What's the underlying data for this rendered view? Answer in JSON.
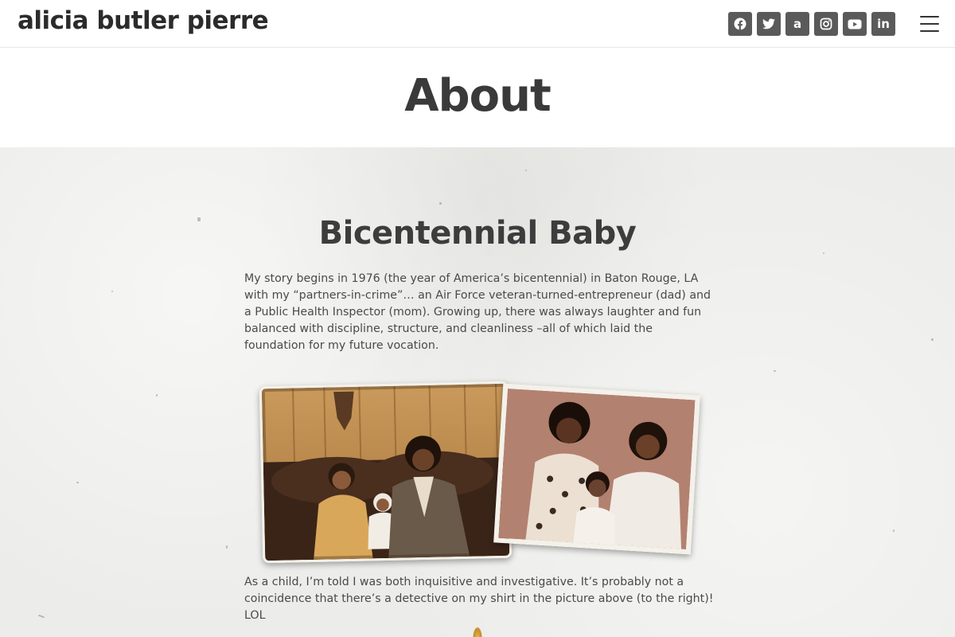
{
  "header": {
    "site_title": "alicia butler pierre",
    "social": [
      {
        "name": "facebook-icon",
        "color": "#5a5a5a"
      },
      {
        "name": "twitter-icon",
        "color": "#5a5a5a"
      },
      {
        "name": "amazon-icon",
        "color": "#5a5a5a",
        "glyph": "a"
      },
      {
        "name": "instagram-icon",
        "color": "#5a5a5a"
      },
      {
        "name": "youtube-icon",
        "color": "#5a5a5a"
      },
      {
        "name": "linkedin-icon",
        "color": "#5a5a5a",
        "glyph": "in"
      }
    ],
    "menu_icon": "hamburger-menu-icon"
  },
  "page": {
    "title": "About"
  },
  "content": {
    "section_heading": "Bicentennial Baby",
    "paragraph_1": "My story begins in 1976 (the year of America’s bicentennial) in Baton Rouge, LA with my “partners-in-crime”… an Air Force veteran-turned-entrepreneur (dad) and a Public Health Inspector (mom). Growing up, there was always laughter and fun balanced with discipline, structure, and cleanliness –all of which laid the foundation for my future vocation.",
    "paragraph_2": "As a child, I’m told I was both inquisitive and investigative. It’s probably not a coincidence that there’s a detective on my shirt in the picture above (to the right)! LOL",
    "photos": [
      {
        "name": "family-photo-sepia"
      },
      {
        "name": "family-photo-portrait"
      }
    ]
  },
  "colors": {
    "text_dark": "#2b2b2b",
    "body_text": "#4a4a4a",
    "social_bg": "#5a5a5a",
    "paper_bg": "#ececea"
  }
}
